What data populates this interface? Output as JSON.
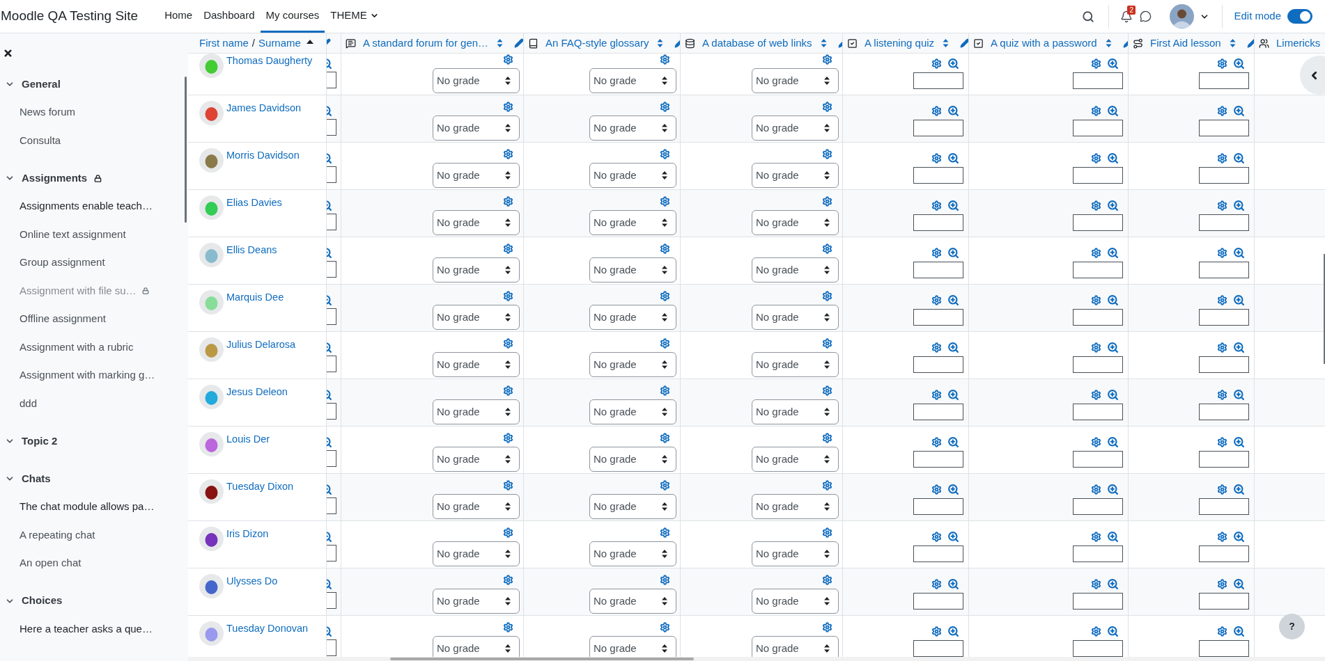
{
  "navbar": {
    "brand": "Moodle QA Testing Site",
    "nav": [
      {
        "label": "Home",
        "selected": false,
        "dropdown": false
      },
      {
        "label": "Dashboard",
        "selected": false,
        "dropdown": false
      },
      {
        "label": "My courses",
        "selected": true,
        "dropdown": false
      },
      {
        "label": "THEME",
        "selected": false,
        "dropdown": true
      }
    ],
    "notifications_badge": "2",
    "edit_mode": {
      "label": "Edit mode",
      "on": true
    }
  },
  "sidebar": {
    "sections": [
      {
        "title": "General",
        "expanded": true,
        "locked": false,
        "items": [
          {
            "label": "News forum",
            "kind": "activity",
            "restricted": false
          },
          {
            "label": "Consulta",
            "kind": "activity",
            "restricted": false
          }
        ]
      },
      {
        "title": "Assignments",
        "expanded": true,
        "locked": true,
        "items": [
          {
            "label": "Assignments enable teach…",
            "kind": "label",
            "restricted": false
          },
          {
            "label": "Online text assignment",
            "kind": "activity",
            "restricted": false
          },
          {
            "label": "Group assignment",
            "kind": "activity",
            "restricted": false
          },
          {
            "label": "Assignment with file su…",
            "kind": "activity",
            "restricted": true
          },
          {
            "label": "Offline assignment",
            "kind": "activity",
            "restricted": false
          },
          {
            "label": "Assignment with a rubric",
            "kind": "activity",
            "restricted": false
          },
          {
            "label": "Assignment with marking g…",
            "kind": "activity",
            "restricted": false
          },
          {
            "label": "ddd",
            "kind": "activity",
            "restricted": false
          }
        ]
      },
      {
        "title": "Topic 2",
        "expanded": true,
        "locked": false
      },
      {
        "title": "Chats",
        "expanded": true,
        "locked": false,
        "items": [
          {
            "label": "The chat module allows pa…",
            "kind": "label",
            "restricted": false
          },
          {
            "label": "A repeating chat",
            "kind": "activity",
            "restricted": false
          },
          {
            "label": "An open chat",
            "kind": "activity",
            "restricted": false
          }
        ]
      },
      {
        "title": "Choices",
        "expanded": true,
        "locked": false,
        "items": [
          {
            "label": "Here a teacher asks a que…",
            "kind": "label",
            "restricted": false
          }
        ]
      }
    ]
  },
  "table": {
    "name_header": {
      "first": "First name",
      "separator": "/",
      "last": "Surname"
    },
    "columns": [
      {
        "title": "A standard forum for gen…",
        "kind": "forum"
      },
      {
        "title": "An FAQ-style glossary",
        "kind": "glossary"
      },
      {
        "title": "A database of web links",
        "kind": "database"
      },
      {
        "title": "A listening quiz",
        "kind": "quiz"
      },
      {
        "title": "A quiz with a password",
        "kind": "quiz"
      },
      {
        "title": "First Aid lesson",
        "kind": "lesson"
      },
      {
        "title": "Limericks",
        "kind": "workshop"
      }
    ],
    "rows": [
      {
        "name": "Thomas Daugherty",
        "color": "#44cc33",
        "grades": [
          "No grade",
          "No grade",
          "No grade"
        ]
      },
      {
        "name": "James Davidson",
        "color": "#dd4433",
        "grades": [
          "No grade",
          "No grade",
          "No grade"
        ]
      },
      {
        "name": "Morris Davidson",
        "color": "#8a7a4a",
        "grades": [
          "No grade",
          "No grade",
          "No grade"
        ]
      },
      {
        "name": "Elias Davies",
        "color": "#33cc55",
        "grades": [
          "No grade",
          "No grade",
          "No grade"
        ]
      },
      {
        "name": "Ellis Deans",
        "color": "#88bbcc",
        "grades": [
          "No grade",
          "No grade",
          "No grade"
        ]
      },
      {
        "name": "Marquis Dee",
        "color": "#88dd99",
        "grades": [
          "No grade",
          "No grade",
          "No grade"
        ]
      },
      {
        "name": "Julius Delarosa",
        "color": "#bb9944",
        "grades": [
          "No grade",
          "No grade",
          "No grade"
        ]
      },
      {
        "name": "Jesus Deleon",
        "color": "#22aadd",
        "grades": [
          "No grade",
          "No grade",
          "No grade"
        ]
      },
      {
        "name": "Louis Der",
        "color": "#bb66dd",
        "grades": [
          "No grade",
          "No grade",
          "No grade"
        ]
      },
      {
        "name": "Tuesday Dixon",
        "color": "#881111",
        "grades": [
          "No grade",
          "No grade",
          "No grade"
        ]
      },
      {
        "name": "Iris Dizon",
        "color": "#7733bb",
        "grades": [
          "No grade",
          "No grade",
          "No grade"
        ]
      },
      {
        "name": "Ulysses Do",
        "color": "#4466cc",
        "grades": [
          "No grade",
          "No grade",
          "No grade"
        ]
      },
      {
        "name": "Tuesday Donovan",
        "color": "#9999ee",
        "grades": [
          "No grade",
          "No grade",
          "No grade"
        ]
      }
    ]
  },
  "help_button": "?"
}
